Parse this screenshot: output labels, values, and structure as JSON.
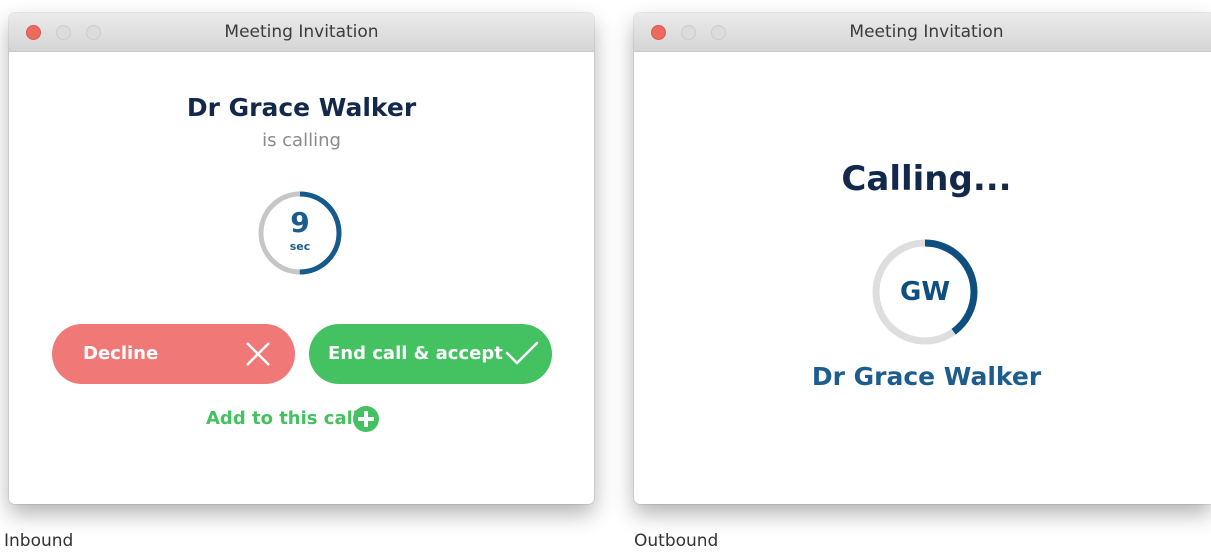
{
  "inbound": {
    "window_title": "Meeting Invitation",
    "caller_name": "Dr Grace Walker",
    "caller_status": "is calling",
    "countdown": {
      "value": "9",
      "unit": "sec",
      "progress": 0.5
    },
    "decline_label": "Decline",
    "accept_label": "End call & accept",
    "add_label": "Add to this call",
    "caption": "Inbound"
  },
  "outbound": {
    "window_title": "Meeting Invitation",
    "status_title": "Calling...",
    "initials": "GW",
    "ring_progress": 0.4,
    "callee_name": "Dr Grace Walker",
    "caption": "Outbound"
  },
  "colors": {
    "decline": "#f07876",
    "accept": "#44c160",
    "navy": "#13294b",
    "accent_blue": "#1a5c8f",
    "close_light": "#ee6a5f"
  },
  "icons": {
    "decline": "close-x-icon",
    "accept": "checkmark-icon",
    "add": "plus-circle-icon"
  }
}
